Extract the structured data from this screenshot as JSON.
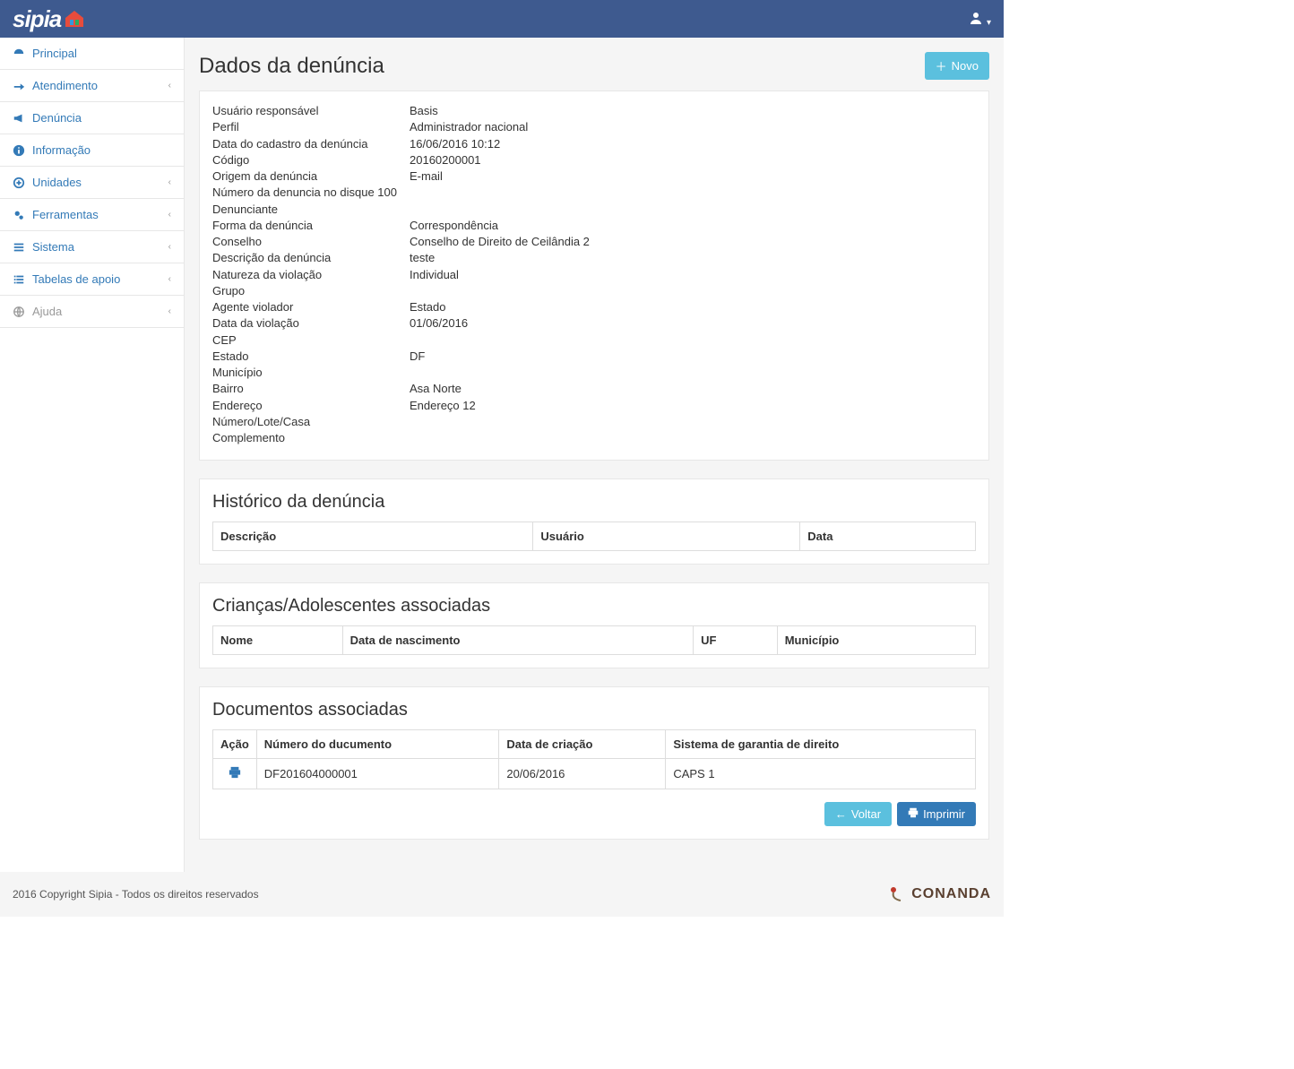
{
  "brand": "sipia",
  "sidebar": {
    "items": [
      {
        "label": "Principal",
        "icon": "dashboard",
        "chevron": false,
        "disabled": false
      },
      {
        "label": "Atendimento",
        "icon": "share",
        "chevron": true,
        "disabled": false
      },
      {
        "label": "Denúncia",
        "icon": "bullhorn",
        "chevron": false,
        "disabled": false
      },
      {
        "label": "Informação",
        "icon": "info",
        "chevron": false,
        "disabled": false
      },
      {
        "label": "Unidades",
        "icon": "plus-circle",
        "chevron": true,
        "disabled": false
      },
      {
        "label": "Ferramentas",
        "icon": "gears",
        "chevron": true,
        "disabled": false
      },
      {
        "label": "Sistema",
        "icon": "sliders",
        "chevron": true,
        "disabled": false
      },
      {
        "label": "Tabelas de apoio",
        "icon": "list",
        "chevron": true,
        "disabled": false
      },
      {
        "label": "Ajuda",
        "icon": "globe",
        "chevron": true,
        "disabled": true
      }
    ]
  },
  "page": {
    "title": "Dados da denúncia",
    "new_button": "Novo"
  },
  "details": [
    {
      "label": "Usuário responsável",
      "value": "Basis"
    },
    {
      "label": "Perfil",
      "value": "Administrador nacional"
    },
    {
      "label": "Data do cadastro da denúncia",
      "value": "16/06/2016 10:12"
    },
    {
      "label": "Código",
      "value": "20160200001"
    },
    {
      "label": "Origem da denúncia",
      "value": "E-mail"
    },
    {
      "label": "Número da denuncia no disque 100",
      "value": ""
    },
    {
      "label": "Denunciante",
      "value": ""
    },
    {
      "label": "Forma da denúncia",
      "value": "Correspondência"
    },
    {
      "label": "Conselho",
      "value": "Conselho de Direito de Ceilândia 2"
    },
    {
      "label": "Descrição da denúncia",
      "value": "teste"
    },
    {
      "label": "Natureza da violação",
      "value": "Individual"
    },
    {
      "label": "Grupo",
      "value": ""
    },
    {
      "label": "Agente violador",
      "value": "Estado"
    },
    {
      "label": "Data da violação",
      "value": "01/06/2016"
    },
    {
      "label": "CEP",
      "value": ""
    },
    {
      "label": "Estado",
      "value": "DF"
    },
    {
      "label": "Município",
      "value": ""
    },
    {
      "label": "Bairro",
      "value": "Asa Norte"
    },
    {
      "label": "Endereço",
      "value": "Endereço 12"
    },
    {
      "label": "Número/Lote/Casa",
      "value": ""
    },
    {
      "label": "Complemento",
      "value": ""
    }
  ],
  "history": {
    "title": "Histórico da denúncia",
    "headers": [
      "Descrição",
      "Usuário",
      "Data"
    ],
    "rows": []
  },
  "children": {
    "title": "Crianças/Adolescentes associadas",
    "headers": [
      "Nome",
      "Data de nascimento",
      "UF",
      "Município"
    ],
    "rows": []
  },
  "documents": {
    "title": "Documentos associadas",
    "headers": [
      "Ação",
      "Número do ducumento",
      "Data de criação",
      "Sistema de garantia de direito"
    ],
    "rows": [
      {
        "numero": "DF201604000001",
        "data": "20/06/2016",
        "sistema": "CAPS 1"
      }
    ]
  },
  "buttons": {
    "voltar": "Voltar",
    "imprimir": "Imprimir"
  },
  "footer": {
    "copyright": "2016 Copyright Sipia - Todos os direitos reservados",
    "org": "CONANDA"
  }
}
